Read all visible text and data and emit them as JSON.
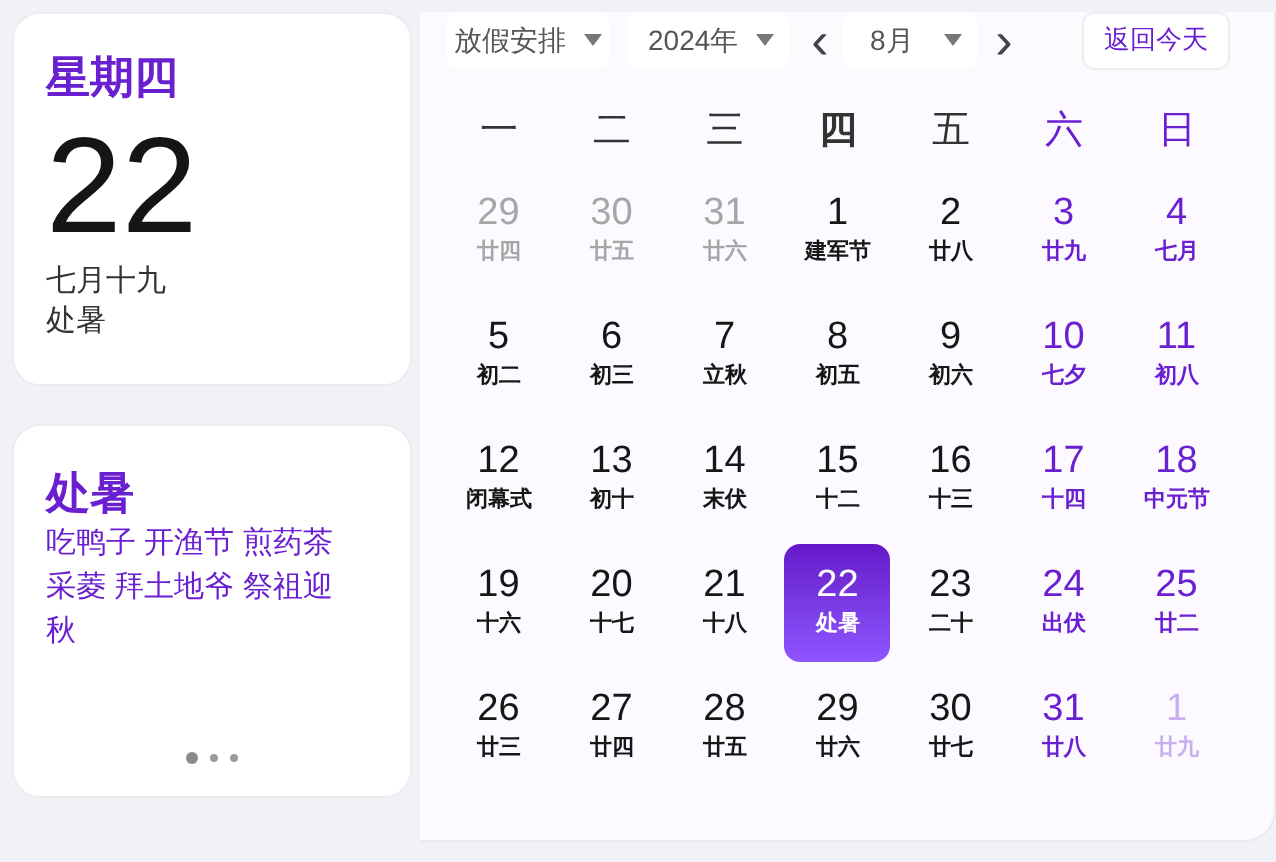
{
  "today_card": {
    "weekday": "星期四",
    "day": "22",
    "lunar_date": "七月十九",
    "term": "处暑"
  },
  "term_card": {
    "title": "处暑",
    "customs": "吃鸭子 开渔节 煎药茶采菱 拜土地爷 祭祖迎秋",
    "pages": [
      {
        "selected": true
      },
      {
        "selected": false
      },
      {
        "selected": false
      }
    ]
  },
  "toolbar": {
    "holiday_select": "放假安排",
    "year_select": "2024年",
    "prev": "‹",
    "month_select": "8月",
    "next": "›",
    "today_button": "返回今天"
  },
  "weekdays": [
    {
      "label": "一",
      "weekend": false,
      "current": false
    },
    {
      "label": "二",
      "weekend": false,
      "current": false
    },
    {
      "label": "三",
      "weekend": false,
      "current": false
    },
    {
      "label": "四",
      "weekend": false,
      "current": true
    },
    {
      "label": "五",
      "weekend": false,
      "current": false
    },
    {
      "label": "六",
      "weekend": true,
      "current": false
    },
    {
      "label": "日",
      "weekend": true,
      "current": false
    }
  ],
  "days": [
    {
      "day": "29",
      "lunar": "廿四",
      "in_month": false,
      "weekend": false,
      "selected": false
    },
    {
      "day": "30",
      "lunar": "廿五",
      "in_month": false,
      "weekend": false,
      "selected": false
    },
    {
      "day": "31",
      "lunar": "廿六",
      "in_month": false,
      "weekend": false,
      "selected": false
    },
    {
      "day": "1",
      "lunar": "建军节",
      "in_month": true,
      "weekend": false,
      "selected": false
    },
    {
      "day": "2",
      "lunar": "廿八",
      "in_month": true,
      "weekend": false,
      "selected": false
    },
    {
      "day": "3",
      "lunar": "廿九",
      "in_month": true,
      "weekend": true,
      "selected": false
    },
    {
      "day": "4",
      "lunar": "七月",
      "in_month": true,
      "weekend": true,
      "selected": false
    },
    {
      "day": "5",
      "lunar": "初二",
      "in_month": true,
      "weekend": false,
      "selected": false
    },
    {
      "day": "6",
      "lunar": "初三",
      "in_month": true,
      "weekend": false,
      "selected": false
    },
    {
      "day": "7",
      "lunar": "立秋",
      "in_month": true,
      "weekend": false,
      "selected": false
    },
    {
      "day": "8",
      "lunar": "初五",
      "in_month": true,
      "weekend": false,
      "selected": false
    },
    {
      "day": "9",
      "lunar": "初六",
      "in_month": true,
      "weekend": false,
      "selected": false
    },
    {
      "day": "10",
      "lunar": "七夕",
      "in_month": true,
      "weekend": true,
      "selected": false
    },
    {
      "day": "11",
      "lunar": "初八",
      "in_month": true,
      "weekend": true,
      "selected": false
    },
    {
      "day": "12",
      "lunar": "闭幕式",
      "in_month": true,
      "weekend": false,
      "selected": false
    },
    {
      "day": "13",
      "lunar": "初十",
      "in_month": true,
      "weekend": false,
      "selected": false
    },
    {
      "day": "14",
      "lunar": "末伏",
      "in_month": true,
      "weekend": false,
      "selected": false
    },
    {
      "day": "15",
      "lunar": "十二",
      "in_month": true,
      "weekend": false,
      "selected": false
    },
    {
      "day": "16",
      "lunar": "十三",
      "in_month": true,
      "weekend": false,
      "selected": false
    },
    {
      "day": "17",
      "lunar": "十四",
      "in_month": true,
      "weekend": true,
      "selected": false
    },
    {
      "day": "18",
      "lunar": "中元节",
      "in_month": true,
      "weekend": true,
      "selected": false
    },
    {
      "day": "19",
      "lunar": "十六",
      "in_month": true,
      "weekend": false,
      "selected": false
    },
    {
      "day": "20",
      "lunar": "十七",
      "in_month": true,
      "weekend": false,
      "selected": false
    },
    {
      "day": "21",
      "lunar": "十八",
      "in_month": true,
      "weekend": false,
      "selected": false
    },
    {
      "day": "22",
      "lunar": "处暑",
      "in_month": true,
      "weekend": false,
      "selected": true
    },
    {
      "day": "23",
      "lunar": "二十",
      "in_month": true,
      "weekend": false,
      "selected": false
    },
    {
      "day": "24",
      "lunar": "出伏",
      "in_month": true,
      "weekend": true,
      "selected": false
    },
    {
      "day": "25",
      "lunar": "廿二",
      "in_month": true,
      "weekend": true,
      "selected": false
    },
    {
      "day": "26",
      "lunar": "廿三",
      "in_month": true,
      "weekend": false,
      "selected": false
    },
    {
      "day": "27",
      "lunar": "廿四",
      "in_month": true,
      "weekend": false,
      "selected": false
    },
    {
      "day": "28",
      "lunar": "廿五",
      "in_month": true,
      "weekend": false,
      "selected": false
    },
    {
      "day": "29",
      "lunar": "廿六",
      "in_month": true,
      "weekend": false,
      "selected": false
    },
    {
      "day": "30",
      "lunar": "廿七",
      "in_month": true,
      "weekend": false,
      "selected": false
    },
    {
      "day": "31",
      "lunar": "廿八",
      "in_month": true,
      "weekend": true,
      "selected": false
    },
    {
      "day": "1",
      "lunar": "廿九",
      "in_month": false,
      "weekend": true,
      "selected": false
    }
  ]
}
